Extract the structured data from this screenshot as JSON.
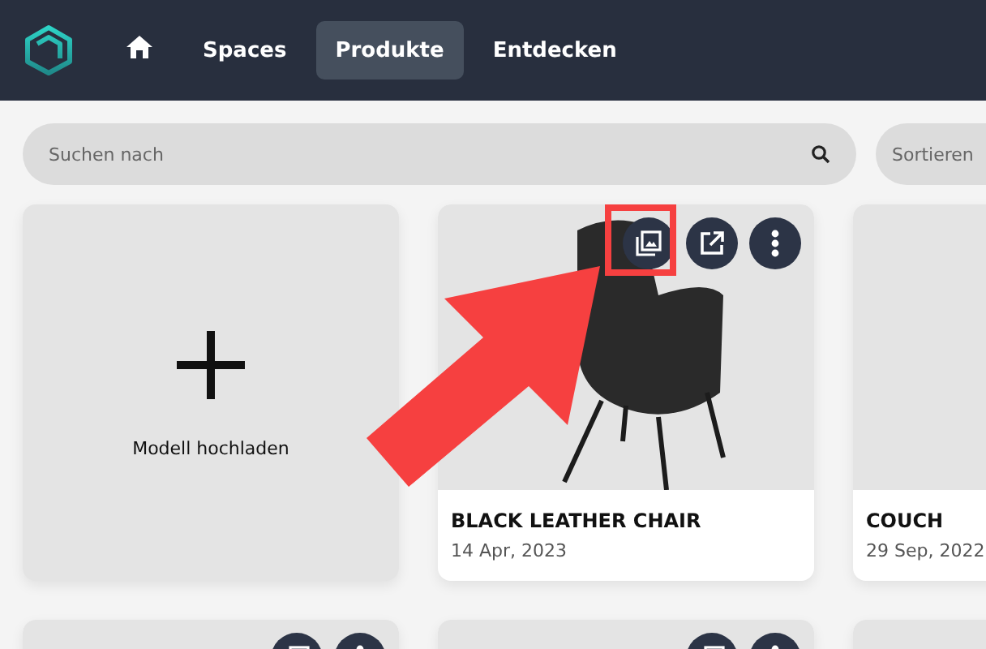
{
  "nav": {
    "items": [
      {
        "kind": "home",
        "selected": false
      },
      {
        "kind": "text",
        "label": "Spaces",
        "selected": false
      },
      {
        "kind": "text",
        "label": "Produkte",
        "selected": true
      },
      {
        "kind": "text",
        "label": "Entdecken",
        "selected": false
      }
    ]
  },
  "search": {
    "placeholder": "Suchen nach"
  },
  "sort": {
    "placeholder": "Sortieren"
  },
  "upload": {
    "label": "Modell hochladen"
  },
  "rows": [
    {
      "cards": [
        {
          "kind": "chair",
          "title": "BLACK LEATHER CHAIR",
          "date": "14 Apr, 2023",
          "buttons": [
            {
              "kind": "gallery"
            },
            {
              "kind": "external"
            },
            {
              "kind": "more"
            }
          ]
        },
        {
          "kind": "couch",
          "title": "COUCH",
          "date": "29 Sep, 2022"
        }
      ]
    },
    {
      "cards": [
        {
          "kind": "blank",
          "buttons": [
            {
              "kind": "gallery"
            },
            {
              "kind": "more"
            }
          ]
        },
        {
          "kind": "blank",
          "buttons": [
            {
              "kind": "gallery"
            },
            {
              "kind": "more"
            }
          ]
        },
        {
          "kind": "blank"
        }
      ]
    }
  ]
}
